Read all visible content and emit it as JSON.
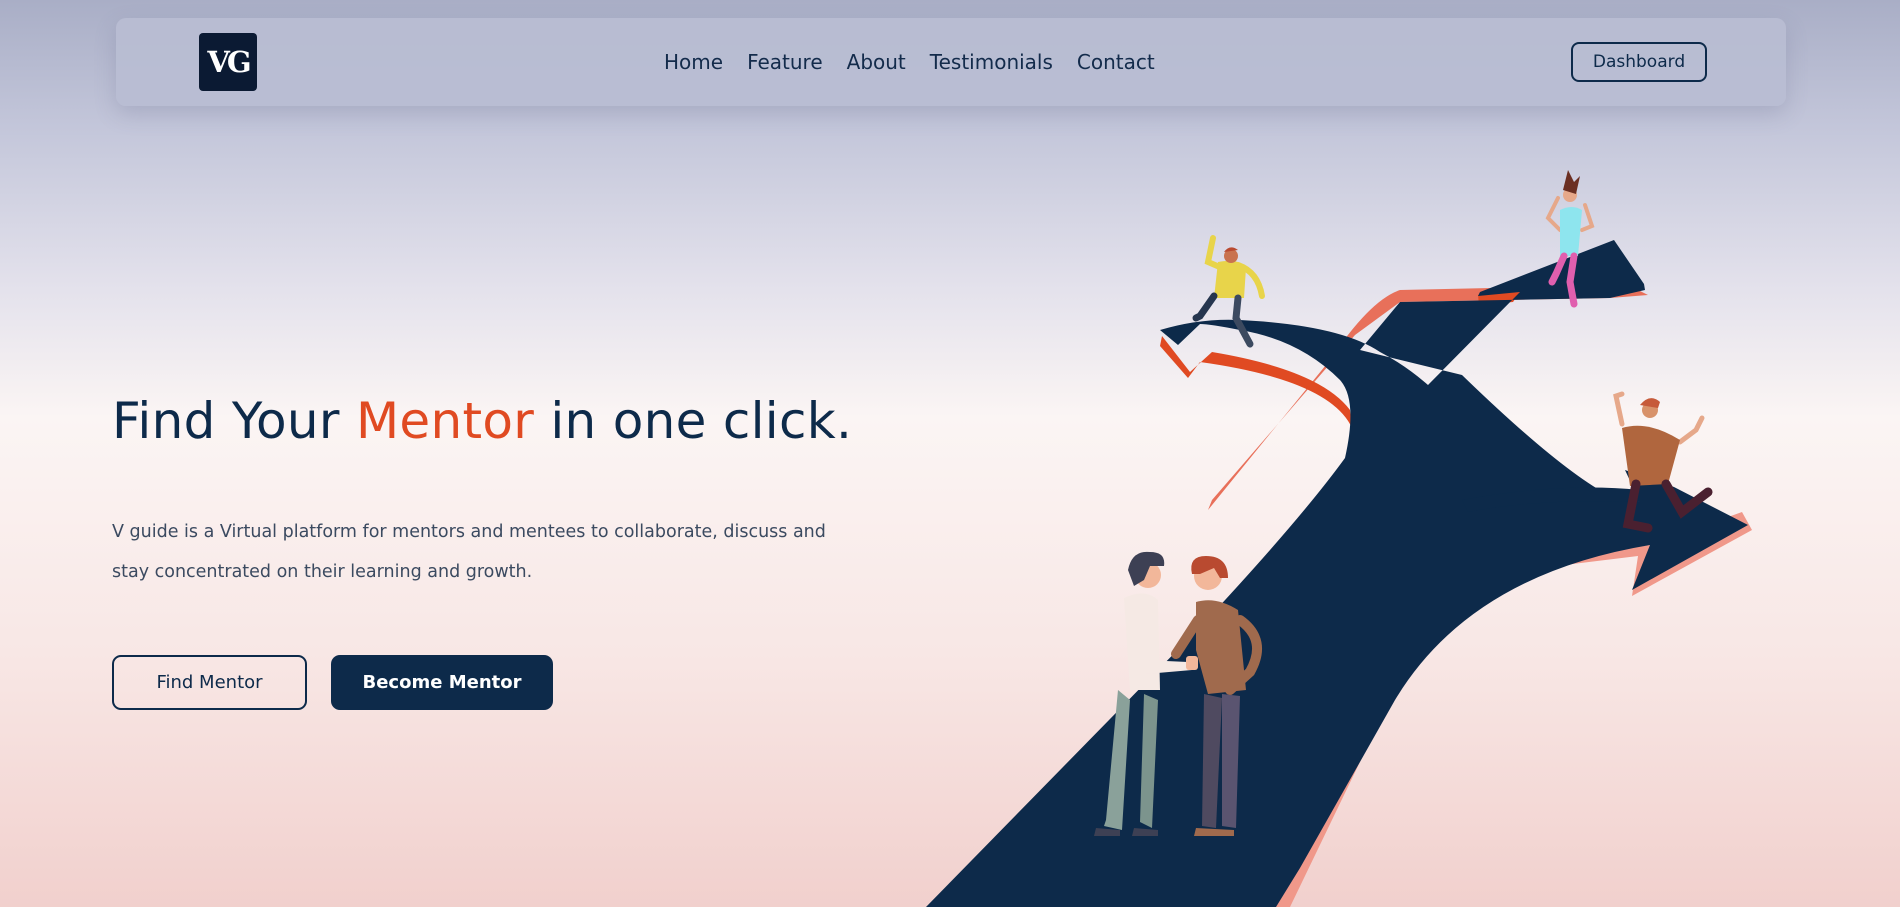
{
  "brand": {
    "logo_text": "VG"
  },
  "nav": {
    "links": [
      "Home",
      "Feature",
      "About",
      "Testimonials",
      "Contact"
    ],
    "dashboard_label": "Dashboard"
  },
  "hero": {
    "title_before": "Find Your ",
    "title_accent": "Mentor",
    "title_after": " in one click.",
    "description": "V guide is a Virtual platform for mentors and mentees to collaborate, discuss and stay concentrated on their learning and growth.",
    "find_mentor_label": "Find Mentor",
    "become_mentor_label": "Become Mentor"
  },
  "colors": {
    "primary": "#0d2a4a",
    "accent": "#e04a22",
    "nav_bg": "#b9bdd2"
  },
  "illustration": {
    "subject": "mentors-crossroads-illustration"
  }
}
